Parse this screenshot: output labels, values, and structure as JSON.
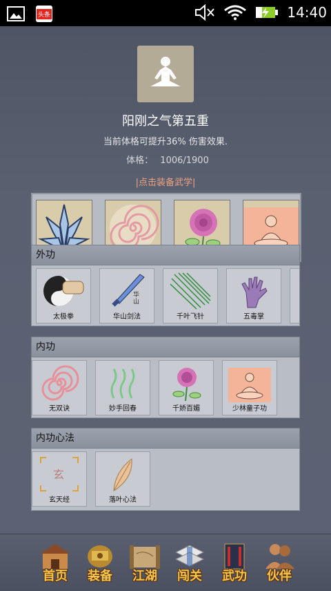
{
  "status_bar": {
    "time": "14:40",
    "news_badge": "头条"
  },
  "profile": {
    "title": "阳刚之气第五重",
    "description": "当前体格可提升36% 伤害效果.",
    "stat_label": "体格：",
    "stat_value": "1006/1900",
    "equip_link": "|点击装备武学|"
  },
  "equipped_slots": [
    "flying-blades-icon",
    "spiral-icon",
    "rose-icon",
    "meditating-monk-icon"
  ],
  "sections": [
    {
      "title": "外功",
      "items": [
        {
          "label": "太极拳",
          "icon": "taiji-fist-icon"
        },
        {
          "label": "华山剑法",
          "icon": "sword-icon"
        },
        {
          "label": "千叶飞针",
          "icon": "needles-icon"
        },
        {
          "label": "五毒掌",
          "icon": "poison-palm-icon"
        }
      ]
    },
    {
      "title": "内功",
      "items": [
        {
          "label": "无双诀",
          "icon": "spiral-icon"
        },
        {
          "label": "妙手回春",
          "icon": "healing-waves-icon"
        },
        {
          "label": "千娇百媚",
          "icon": "rose-icon"
        },
        {
          "label": "少林童子功",
          "icon": "meditating-monk-icon"
        }
      ]
    },
    {
      "title": "内功心法",
      "items": [
        {
          "label": "玄天经",
          "icon": "xuan-scroll-icon"
        },
        {
          "label": "落叶心法",
          "icon": "leaf-icon"
        }
      ]
    }
  ],
  "nav": [
    {
      "label": "首页",
      "icon": "home-icon"
    },
    {
      "label": "装备",
      "icon": "equipment-icon"
    },
    {
      "label": "江湖",
      "icon": "map-scroll-icon"
    },
    {
      "label": "闯关",
      "icon": "books-icon"
    },
    {
      "label": "武功",
      "icon": "martial-book-icon"
    },
    {
      "label": "伙伴",
      "icon": "partners-icon"
    }
  ]
}
